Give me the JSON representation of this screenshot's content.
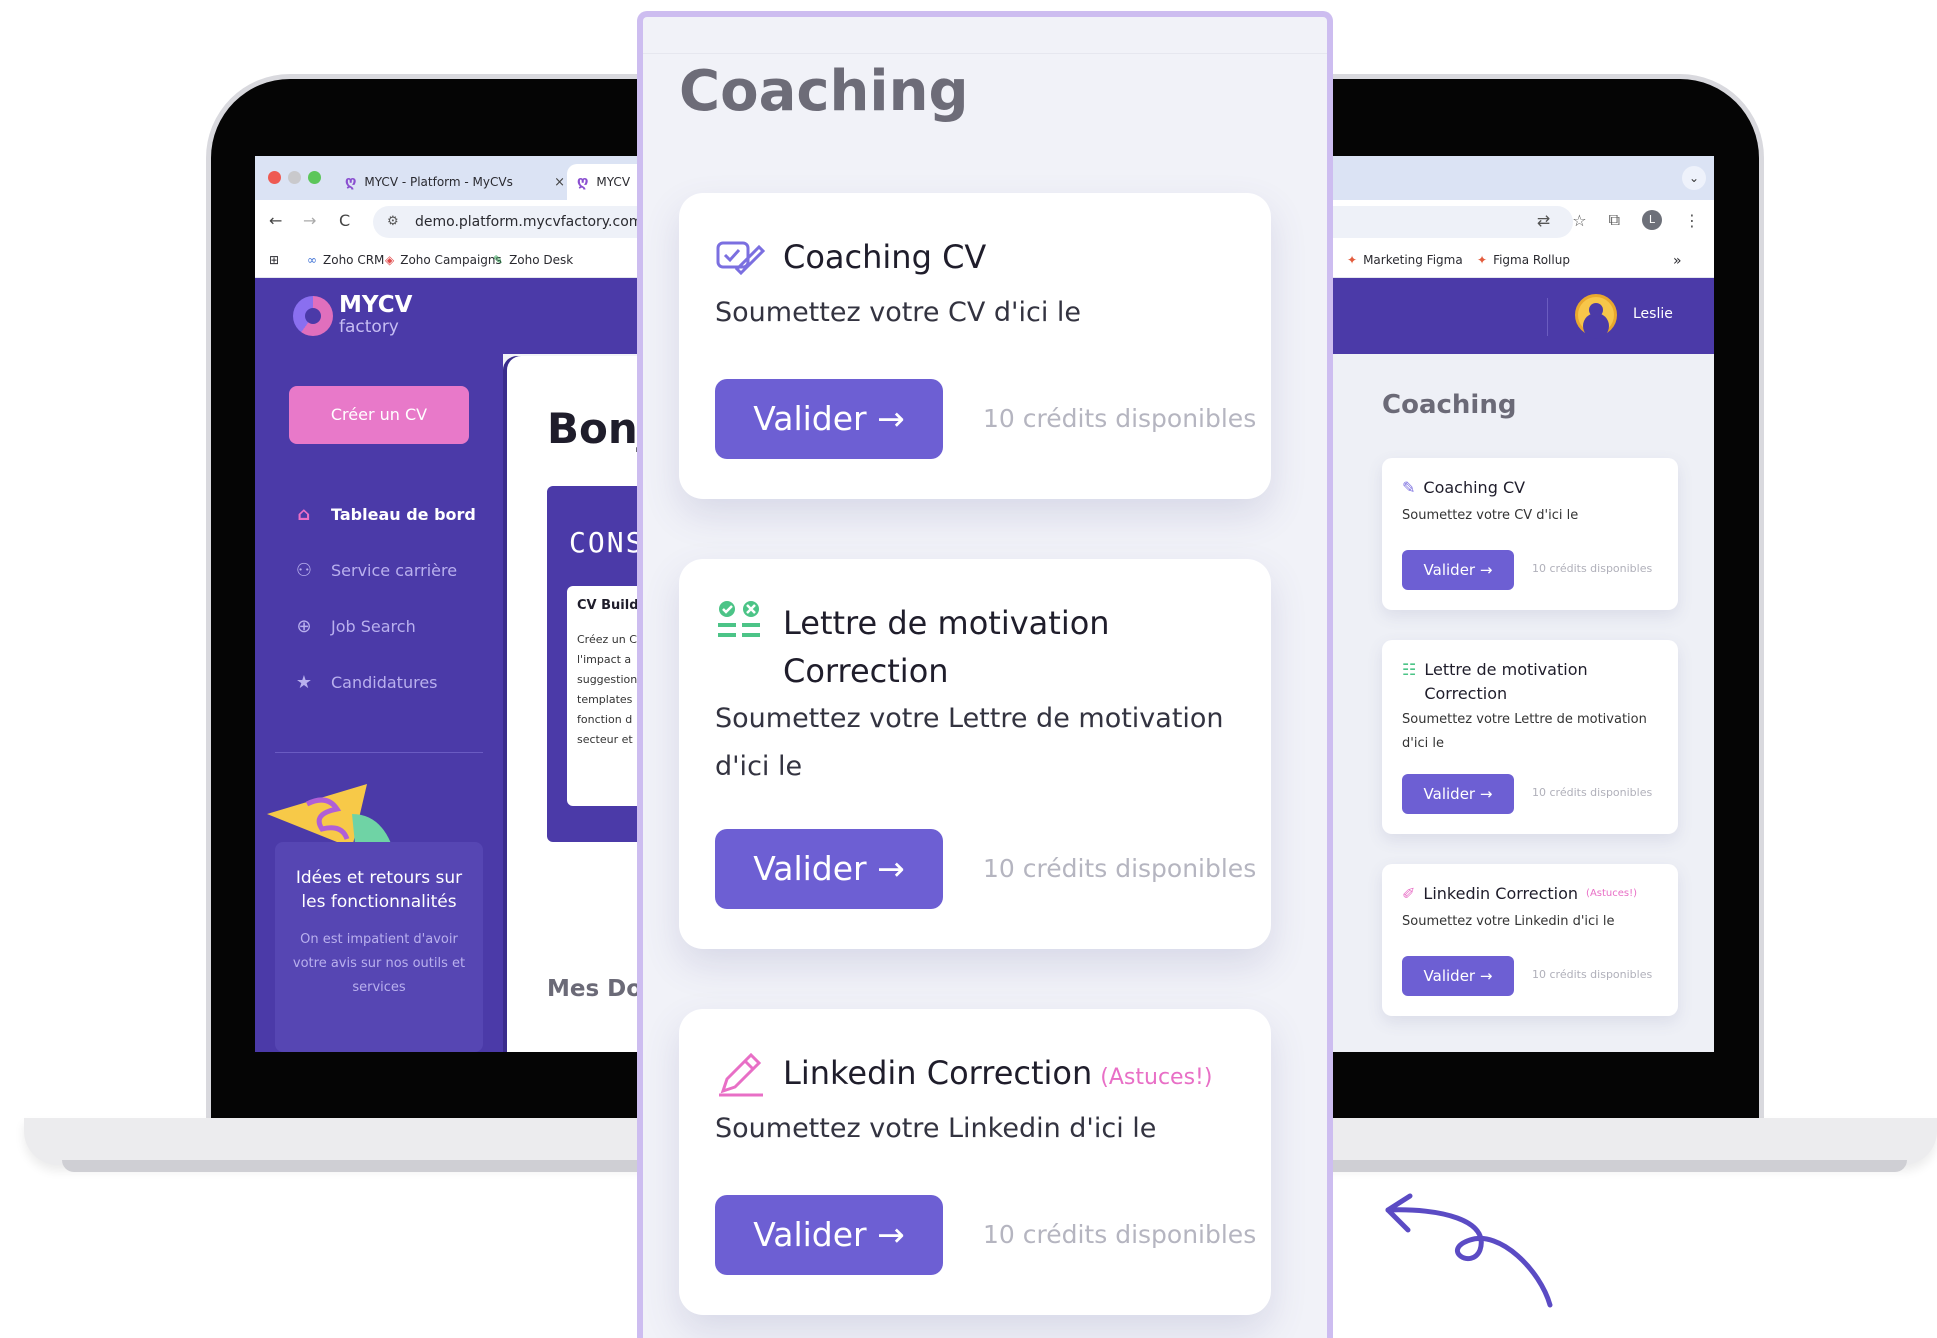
{
  "browser": {
    "tabs": [
      {
        "label": "MYCV - Platform - MyCVs",
        "close": "×"
      },
      {
        "label": "MYCV"
      }
    ],
    "dropdown": "⌄",
    "nav": {
      "back": "←",
      "forward": "→",
      "reload": "C"
    },
    "url": "demo.platform.mycvfactory.com/m",
    "profile_initial": "L",
    "bookmarks": [
      "Zoho CRM",
      "Zoho Campaigns",
      "Zoho Desk",
      "Marketing Figma",
      "Figma Rollup"
    ],
    "bookmarks_more": "»"
  },
  "app": {
    "logo": {
      "brand": "MYCV",
      "sub": "factory"
    },
    "user": {
      "name": "Leslie"
    },
    "sidebar": {
      "create_label": "Créer un CV",
      "items": [
        {
          "label": "Tableau de bord",
          "icon": "home-icon",
          "active": true
        },
        {
          "label": "Service carrière",
          "icon": "network-icon",
          "active": false
        },
        {
          "label": "Job Search",
          "icon": "target-icon",
          "active": false
        },
        {
          "label": "Candidatures",
          "icon": "star-icon",
          "active": false
        }
      ],
      "feedback": {
        "title": "Idées et retours sur les fonctionnalités",
        "text": "On est impatient d'avoir votre avis sur nos outils et services"
      }
    },
    "main": {
      "greeting": "Bonj",
      "promo_title": "CONST",
      "promo_card_title": "CV Build",
      "promo_card_text": "Créez un C\nl'impact a\nsuggestion\ntemplates\nfonction d\nsecteur et",
      "mes_docs": "Mes Do"
    }
  },
  "coaching": {
    "title": "Coaching",
    "cards": [
      {
        "title_line1": "Coaching CV",
        "title_line2": "",
        "astuce": "",
        "desc_line1": "Soumettez votre CV d'ici le",
        "desc_line2": "",
        "button": "Valider →",
        "credits": "10 crédits disponibles",
        "icon": "edit-check-icon"
      },
      {
        "title_line1": "Lettre de motivation",
        "title_line2": "Correction",
        "astuce": "",
        "desc_line1": "Soumettez votre Lettre de motivation",
        "desc_line2": "d'ici le",
        "button": "Valider →",
        "credits": "10 crédits disponibles",
        "icon": "checklist-icon"
      },
      {
        "title_line1": "Linkedin Correction",
        "title_line2": "",
        "astuce": "(Astuces!)",
        "desc_line1": "Soumettez votre Linkedin d'ici le",
        "desc_line2": "",
        "button": "Valider →",
        "credits": "10 crédits disponibles",
        "icon": "pencil-icon"
      }
    ]
  },
  "colors": {
    "primary": "#4b3aa8",
    "button": "#6d5fd3",
    "accent_pink": "#e879c9",
    "green": "#4cc487"
  }
}
